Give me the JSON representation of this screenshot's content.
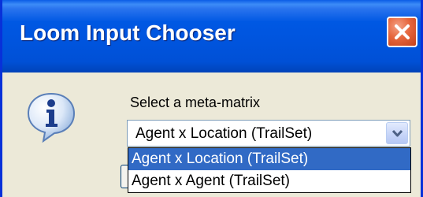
{
  "window": {
    "title": "Loom Input Chooser",
    "close_icon": "close-icon",
    "accent_color": "#0054e3"
  },
  "dialog": {
    "icon": "info-icon",
    "prompt": "Select a meta-matrix",
    "combo": {
      "selected_value": "Agent x Location (TrailSet)",
      "arrow_icon": "chevron-down-icon",
      "options": [
        {
          "label": "Agent x Location (TrailSet)",
          "selected": true
        },
        {
          "label": "Agent x Agent (TrailSet)",
          "selected": false
        }
      ]
    }
  }
}
